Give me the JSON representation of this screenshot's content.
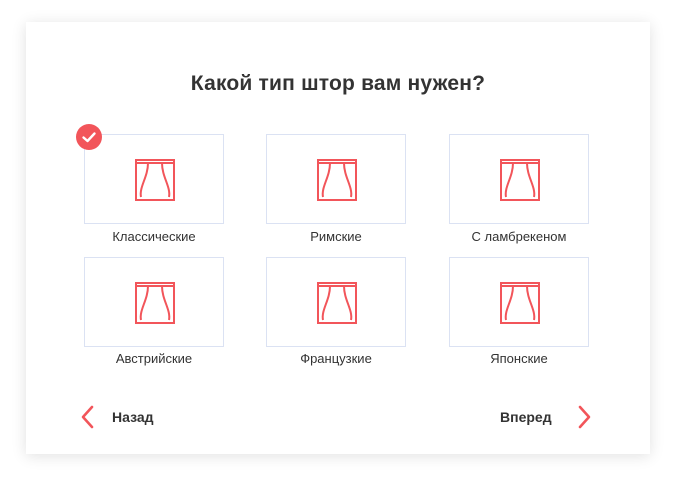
{
  "quiz": {
    "question": "Какой тип штор вам нужен?",
    "options": [
      {
        "label": "Классические",
        "selected": true
      },
      {
        "label": "Римские",
        "selected": false
      },
      {
        "label": "С ламбрекеном",
        "selected": false
      },
      {
        "label": "Австрийские",
        "selected": false
      },
      {
        "label": "Французкие",
        "selected": false
      },
      {
        "label": "Японские",
        "selected": false
      }
    ],
    "back_label": "Назад",
    "next_label": "Вперед"
  },
  "colors": {
    "accent": "#f2555a",
    "tile_border": "#dbe2f3",
    "text": "#333333"
  },
  "icons": {
    "option": "curtain-icon",
    "selected": "checkmark-icon",
    "back": "chevron-left-icon",
    "next": "chevron-right-icon"
  }
}
